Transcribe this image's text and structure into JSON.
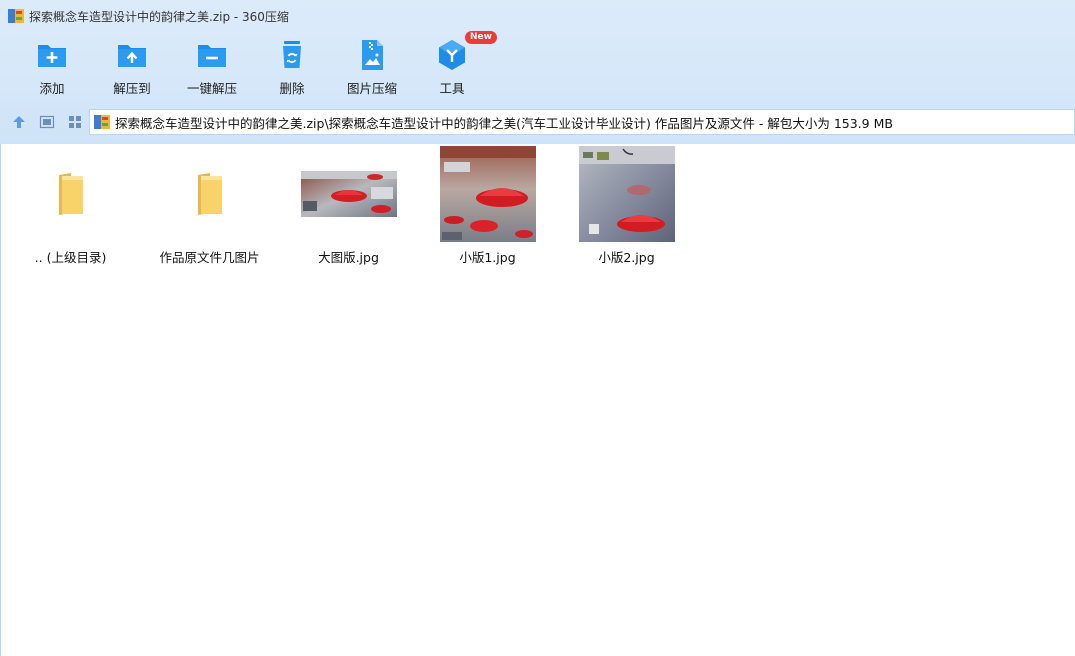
{
  "window": {
    "title": "探索概念车造型设计中的韵律之美.zip - 360压缩"
  },
  "toolbar": {
    "items": [
      {
        "label": "添加",
        "icon": "folder-add-icon"
      },
      {
        "label": "解压到",
        "icon": "folder-extract-icon"
      },
      {
        "label": "一键解压",
        "icon": "folder-one-click-extract-icon"
      },
      {
        "label": "删除",
        "icon": "trash-icon"
      },
      {
        "label": "图片压缩",
        "icon": "image-compress-icon"
      },
      {
        "label": "工具",
        "icon": "tools-cube-icon",
        "badge": "New"
      }
    ]
  },
  "address": {
    "path": "探索概念车造型设计中的韵律之美.zip\\探索概念车造型设计中的韵律之美(汽车工业设计毕业设计)  作品图片及源文件 - 解包大小为 153.9 MB"
  },
  "files": [
    {
      "name": ".. (上级目录)",
      "kind": "folder"
    },
    {
      "name": "作品原文件几图片",
      "kind": "folder"
    },
    {
      "name": "大图版.jpg",
      "kind": "image-wide"
    },
    {
      "name": "小版1.jpg",
      "kind": "image-square"
    },
    {
      "name": "小版2.jpg",
      "kind": "image-square"
    }
  ],
  "colors": {
    "accent_blue": "#1d8de6",
    "badge_red": "#f03a3a",
    "folder_yellow": "#f7d36a"
  }
}
